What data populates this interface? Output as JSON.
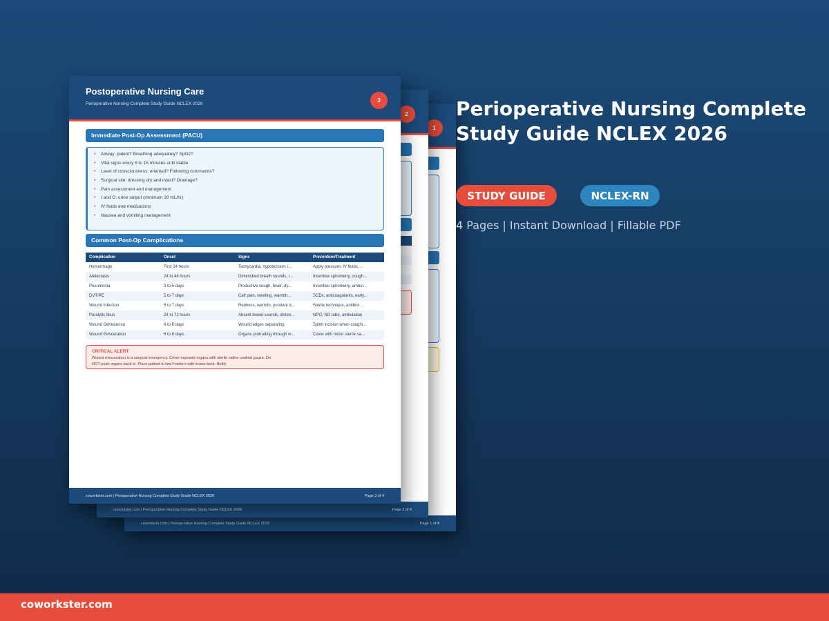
{
  "product": {
    "title": "Perioperative Nursing Complete Study Guide NCLEX 2026",
    "badges": [
      "STUDY GUIDE",
      "NCLEX-RN"
    ],
    "meta": "4 Pages | Instant Download | Fillable PDF"
  },
  "brand": "coworkster.com",
  "pages": {
    "back1": {
      "number": "1",
      "footer_left": "coworkster.com | Perioperative Nursing Complete Study Guide NCLEX 2026",
      "footer_right": "Page 1 of 4"
    },
    "back2": {
      "number": "2",
      "footer_left": "coworkster.com | Perioperative Nursing Complete Study Guide NCLEX 2026",
      "footer_right": "Page 2 of 4"
    },
    "front": {
      "number": "3",
      "title": "Postoperative Nursing Care",
      "subtitle": "Perioperative Nursing Complete Study Guide NCLEX 2026",
      "section1": "Immediate Post-Op Assessment (PACU)",
      "checklist": [
        "Airway: patent? Breathing adequately? SpO2?",
        "Vital signs every 5 to 15 minutes until stable",
        "Level of consciousness: oriented? Following commands?",
        "Surgical site: dressing dry and intact? Drainage?",
        "Pain assessment and management",
        "I and O: urine output (minimum 30 mL/hr)",
        "IV fluids and medications",
        "Nausea and vomiting management"
      ],
      "section2": "Common Post-Op Complications",
      "table": {
        "headers": [
          "Complication",
          "Onset",
          "Signs",
          "Prevention/Treatment"
        ],
        "rows": [
          [
            "Hemorrhage",
            "First 24 hours",
            "Tachycardia, hypotension, i...",
            "Apply pressure, IV fluids, ..."
          ],
          [
            "Atelectasis",
            "24 to 48 hours",
            "Diminished breath sounds, l...",
            "Incentive spirometry, cough..."
          ],
          [
            "Pneumonia",
            "3 to 5 days",
            "Productive cough, fever, dy...",
            "Incentive spirometry, ambul..."
          ],
          [
            "DVT/PE",
            "5 to 7 days",
            "Calf pain, swelling, warmth...",
            "SCDs, anticoagulants, early..."
          ],
          [
            "Wound Infection",
            "5 to 7 days",
            "Redness, warmth, purulent d...",
            "Sterile technique, antibiot..."
          ],
          [
            "Paralytic Ileus",
            "24 to 72 hours",
            "Absent bowel sounds, disten...",
            "NPO, NG tube, ambulation"
          ],
          [
            "Wound Dehiscence",
            "6 to 8 days",
            "Wound edges separating",
            "Splint incision when coughi..."
          ],
          [
            "Wound Evisceration",
            "6 to 8 days",
            "Organs protruding through w...",
            "Cover with moist sterile sa..."
          ]
        ]
      },
      "alert_title": "CRITICAL ALERT",
      "alert_text": "Wound evisceration is a surgical emergency. Cover exposed organs with sterile saline soaked gauze. Do NOT push organs back in. Place patient in low Fowler's with knees bent. Notify",
      "footer_left": "coworkster.com | Perioperative Nursing Complete Study Guide NCLEX 2026",
      "footer_right": "Page 3 of 4"
    }
  },
  "colors": {
    "header": "#1c4b7b",
    "accent": "#e74c3c",
    "section": "#2876b6",
    "badge_blue": "#2e86c1"
  }
}
